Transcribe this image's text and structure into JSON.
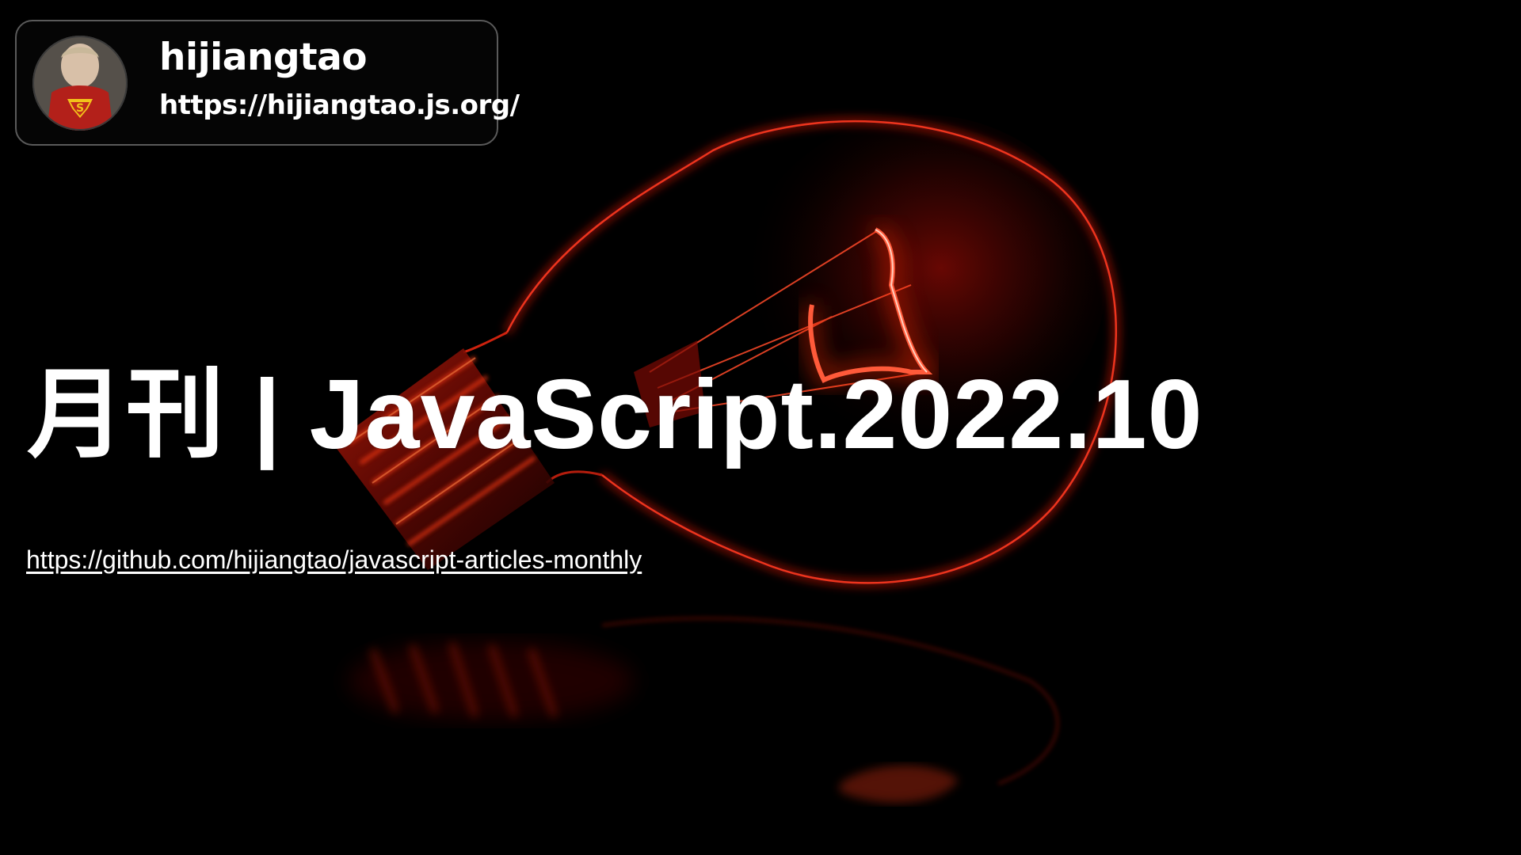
{
  "author": {
    "name": "hijiangtao",
    "url": "https://hijiangtao.js.org/",
    "avatar_icon": "superman-avatar-icon"
  },
  "slide": {
    "title": "月刊 | JavaScript.2022.10",
    "link": "https://github.com/hijiangtao/javascript-articles-monthly",
    "background_icon": "red-lightbulb-icon"
  },
  "colors": {
    "background": "#000000",
    "text": "#ffffff",
    "glow": "#ff1a0a",
    "card_border": "#5a5a5a"
  }
}
